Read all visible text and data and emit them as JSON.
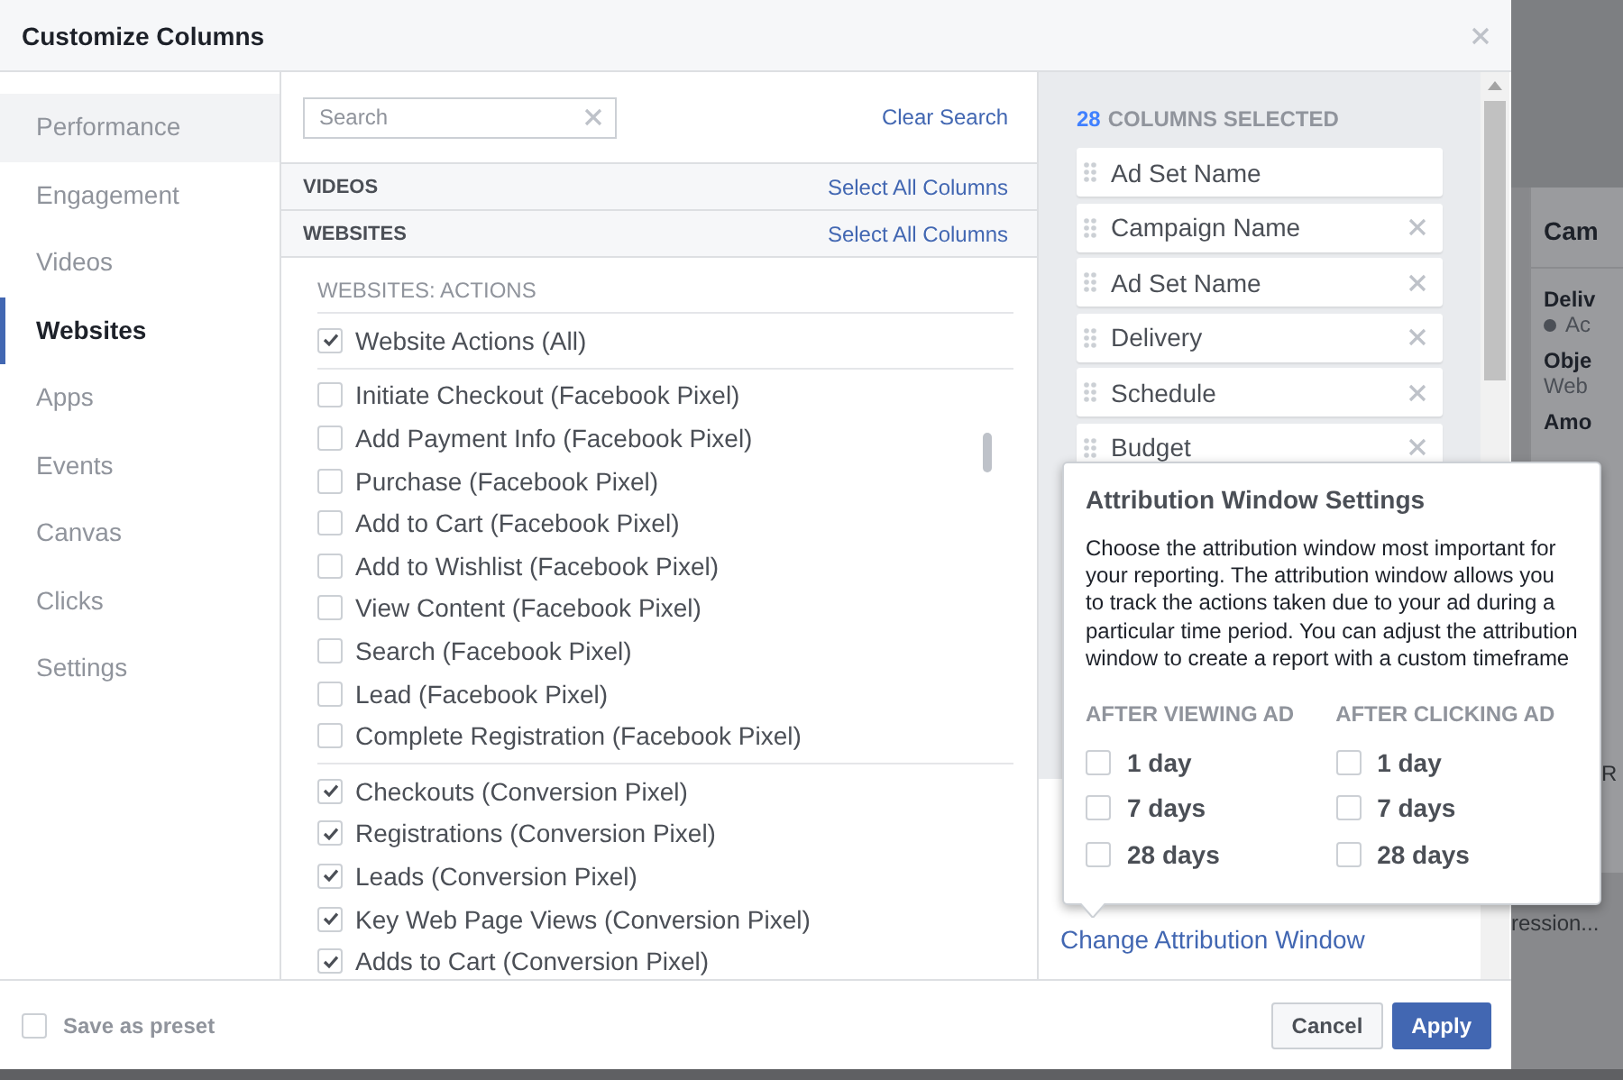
{
  "dialog": {
    "title": "Customize Columns"
  },
  "sidebar": {
    "items": [
      {
        "label": "Performance",
        "selected": false,
        "hovered": true
      },
      {
        "label": "Engagement",
        "selected": false,
        "hovered": false
      },
      {
        "label": "Videos",
        "selected": false,
        "hovered": false
      },
      {
        "label": "Websites",
        "selected": true,
        "hovered": false
      },
      {
        "label": "Apps",
        "selected": false,
        "hovered": false
      },
      {
        "label": "Events",
        "selected": false,
        "hovered": false
      },
      {
        "label": "Canvas",
        "selected": false,
        "hovered": false
      },
      {
        "label": "Clicks",
        "selected": false,
        "hovered": false
      },
      {
        "label": "Settings",
        "selected": false,
        "hovered": false
      }
    ]
  },
  "search": {
    "placeholder": "Search",
    "clear_search": "Clear Search"
  },
  "sections": [
    {
      "title": "VIDEOS",
      "action": "Select All Columns"
    },
    {
      "title": "WEBSITES",
      "action": "Select All Columns"
    }
  ],
  "group": {
    "title": "WEBSITES: ACTIONS",
    "blocks": [
      {
        "items": [
          {
            "label": "Website Actions (All)",
            "checked": true
          }
        ]
      },
      {
        "items": [
          {
            "label": "Initiate Checkout (Facebook Pixel)",
            "checked": false
          },
          {
            "label": "Add Payment Info (Facebook Pixel)",
            "checked": false
          },
          {
            "label": "Purchase (Facebook Pixel)",
            "checked": false
          },
          {
            "label": "Add to Cart (Facebook Pixel)",
            "checked": false
          },
          {
            "label": "Add to Wishlist (Facebook Pixel)",
            "checked": false
          },
          {
            "label": "View Content (Facebook Pixel)",
            "checked": false
          },
          {
            "label": "Search (Facebook Pixel)",
            "checked": false
          },
          {
            "label": "Lead (Facebook Pixel)",
            "checked": false
          },
          {
            "label": "Complete Registration (Facebook Pixel)",
            "checked": false
          }
        ]
      },
      {
        "items": [
          {
            "label": "Checkouts (Conversion Pixel)",
            "checked": true
          },
          {
            "label": "Registrations (Conversion Pixel)",
            "checked": true
          },
          {
            "label": "Leads (Conversion Pixel)",
            "checked": true
          },
          {
            "label": "Key Web Page Views (Conversion Pixel)",
            "checked": true
          },
          {
            "label": "Adds to Cart (Conversion Pixel)",
            "checked": true
          }
        ]
      }
    ]
  },
  "selected_columns": {
    "count": "28",
    "label": "COLUMNS SELECTED",
    "items": [
      {
        "label": "Ad Set Name",
        "removable": false
      },
      {
        "label": "Campaign Name",
        "removable": true
      },
      {
        "label": "Ad Set Name",
        "removable": true
      },
      {
        "label": "Delivery",
        "removable": true
      },
      {
        "label": "Schedule",
        "removable": true
      },
      {
        "label": "Budget",
        "removable": true
      }
    ]
  },
  "attribution_popup": {
    "title": "Attribution Window Settings",
    "description": "Choose the attribution window most important for your reporting. The attribution window allows you to track the actions taken due to your ad during a particular time period. You can adjust the attribution window to create a report with a custom timeframe",
    "columns": [
      {
        "heading": "AFTER VIEWING AD",
        "options": [
          {
            "label": "1 day",
            "checked": false
          },
          {
            "label": "7 days",
            "checked": false
          },
          {
            "label": "28 days",
            "checked": false
          }
        ]
      },
      {
        "heading": "AFTER CLICKING AD",
        "options": [
          {
            "label": "1 day",
            "checked": false
          },
          {
            "label": "7 days",
            "checked": false
          },
          {
            "label": "28 days",
            "checked": false
          }
        ]
      }
    ]
  },
  "change_attribution": "Change Attribution Window",
  "footer": {
    "save_preset": {
      "label": "Save as preset",
      "checked": false
    },
    "buttons": [
      {
        "label": "Cancel",
        "kind": "secondary"
      },
      {
        "label": "Apply",
        "kind": "primary"
      }
    ]
  },
  "background_page": {
    "card_title": "Cam",
    "fields": [
      {
        "label": "Deliv",
        "value": "Ac",
        "kind": "status"
      },
      {
        "label": "Obje",
        "value": "Web",
        "kind": "text"
      },
      {
        "label": "Amo",
        "kind": "text"
      }
    ],
    "row_texts": [
      "R",
      "ression..."
    ]
  }
}
